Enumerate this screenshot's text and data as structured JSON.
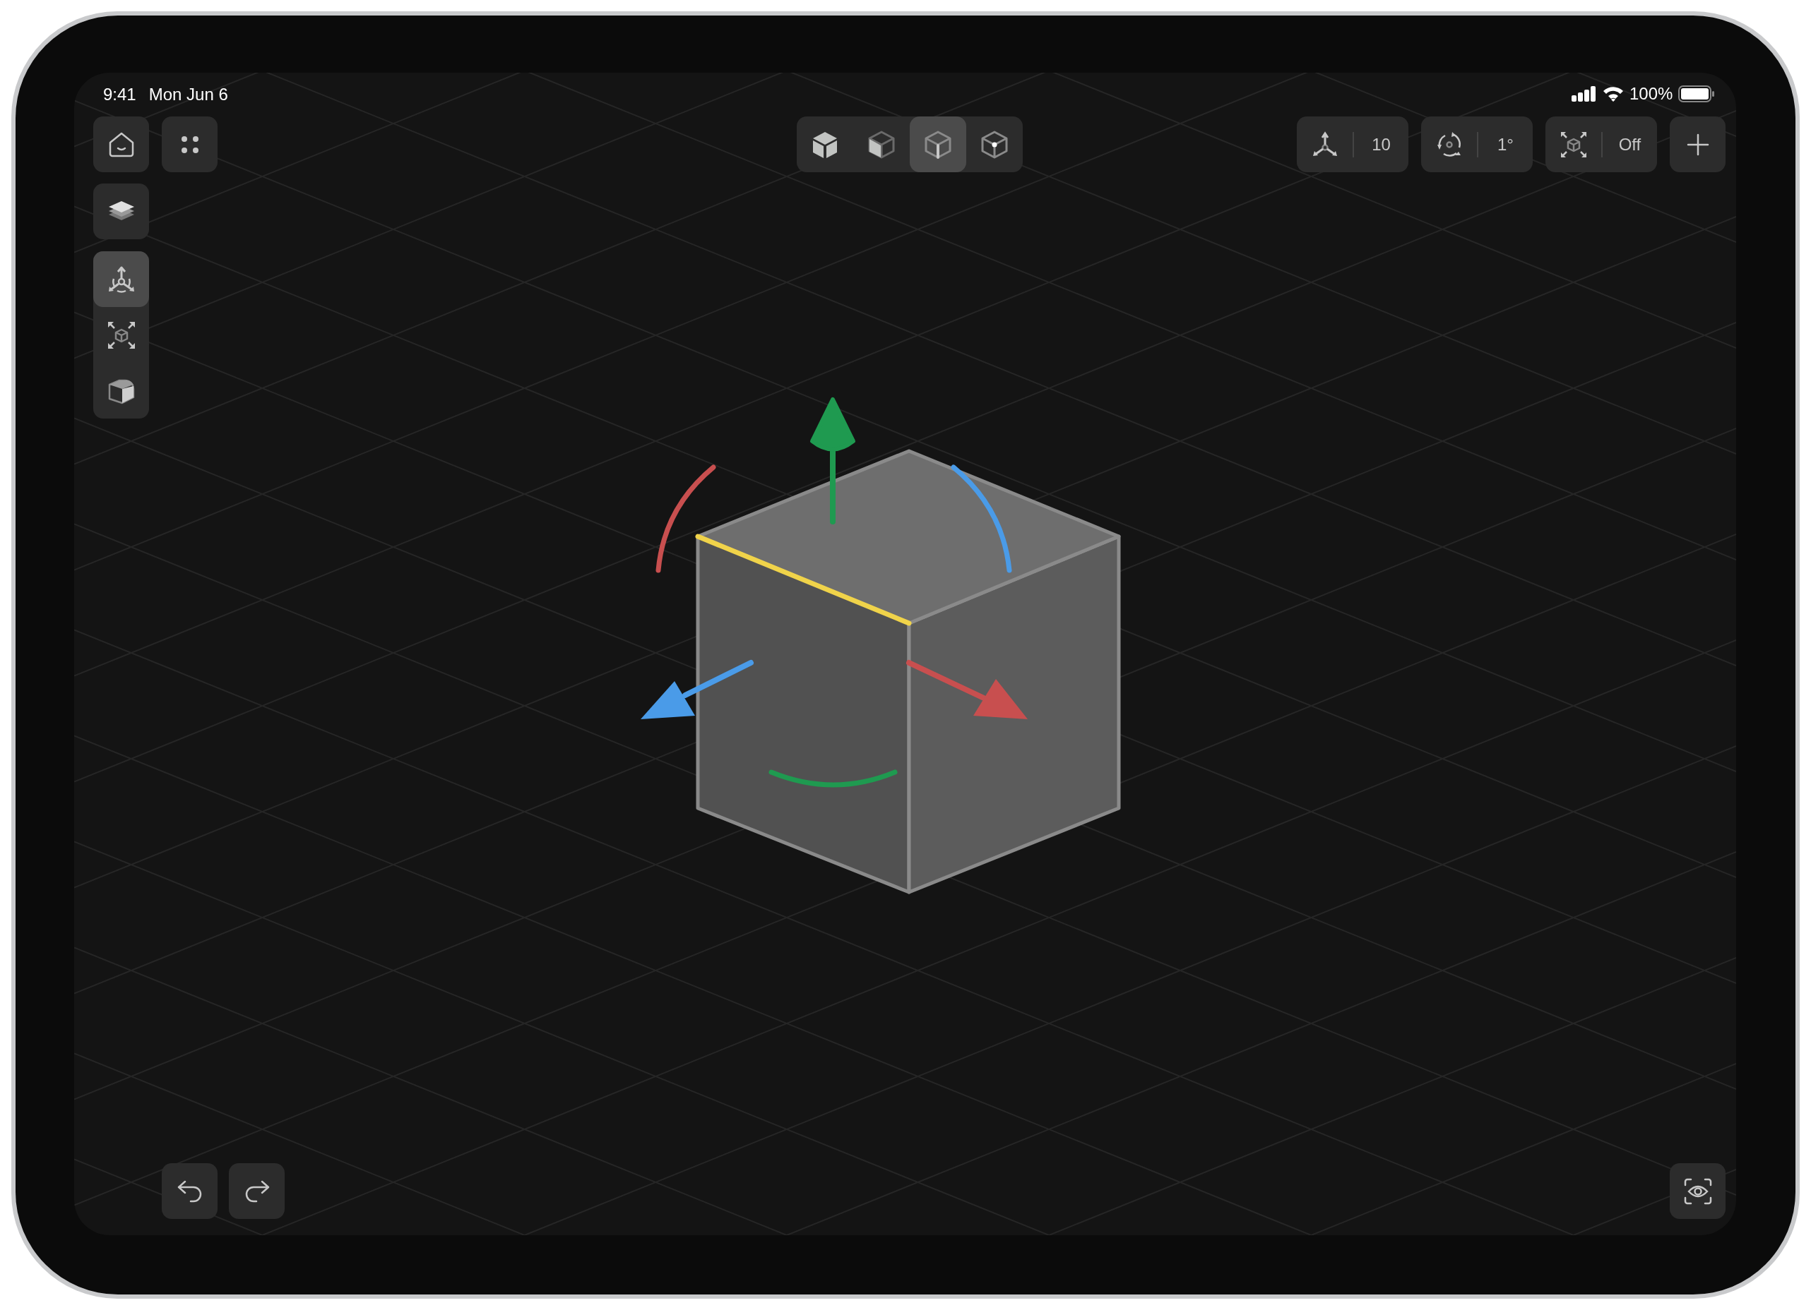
{
  "status_bar": {
    "time": "9:41",
    "date": "Mon Jun 6",
    "battery": "100%"
  },
  "tools": [
    {
      "kind": "move",
      "selected": true
    },
    {
      "kind": "scale",
      "selected": false
    },
    {
      "kind": "shape",
      "selected": false
    }
  ],
  "view_modes": [
    {
      "kind": "solid",
      "selected": false
    },
    {
      "kind": "shaded",
      "selected": false
    },
    {
      "kind": "wireframe",
      "selected": true
    },
    {
      "kind": "vertices",
      "selected": false
    }
  ],
  "snapping": [
    {
      "kind": "move",
      "value": "10"
    },
    {
      "kind": "rotate",
      "value": "1°"
    },
    {
      "kind": "scale",
      "value": "Off"
    }
  ]
}
